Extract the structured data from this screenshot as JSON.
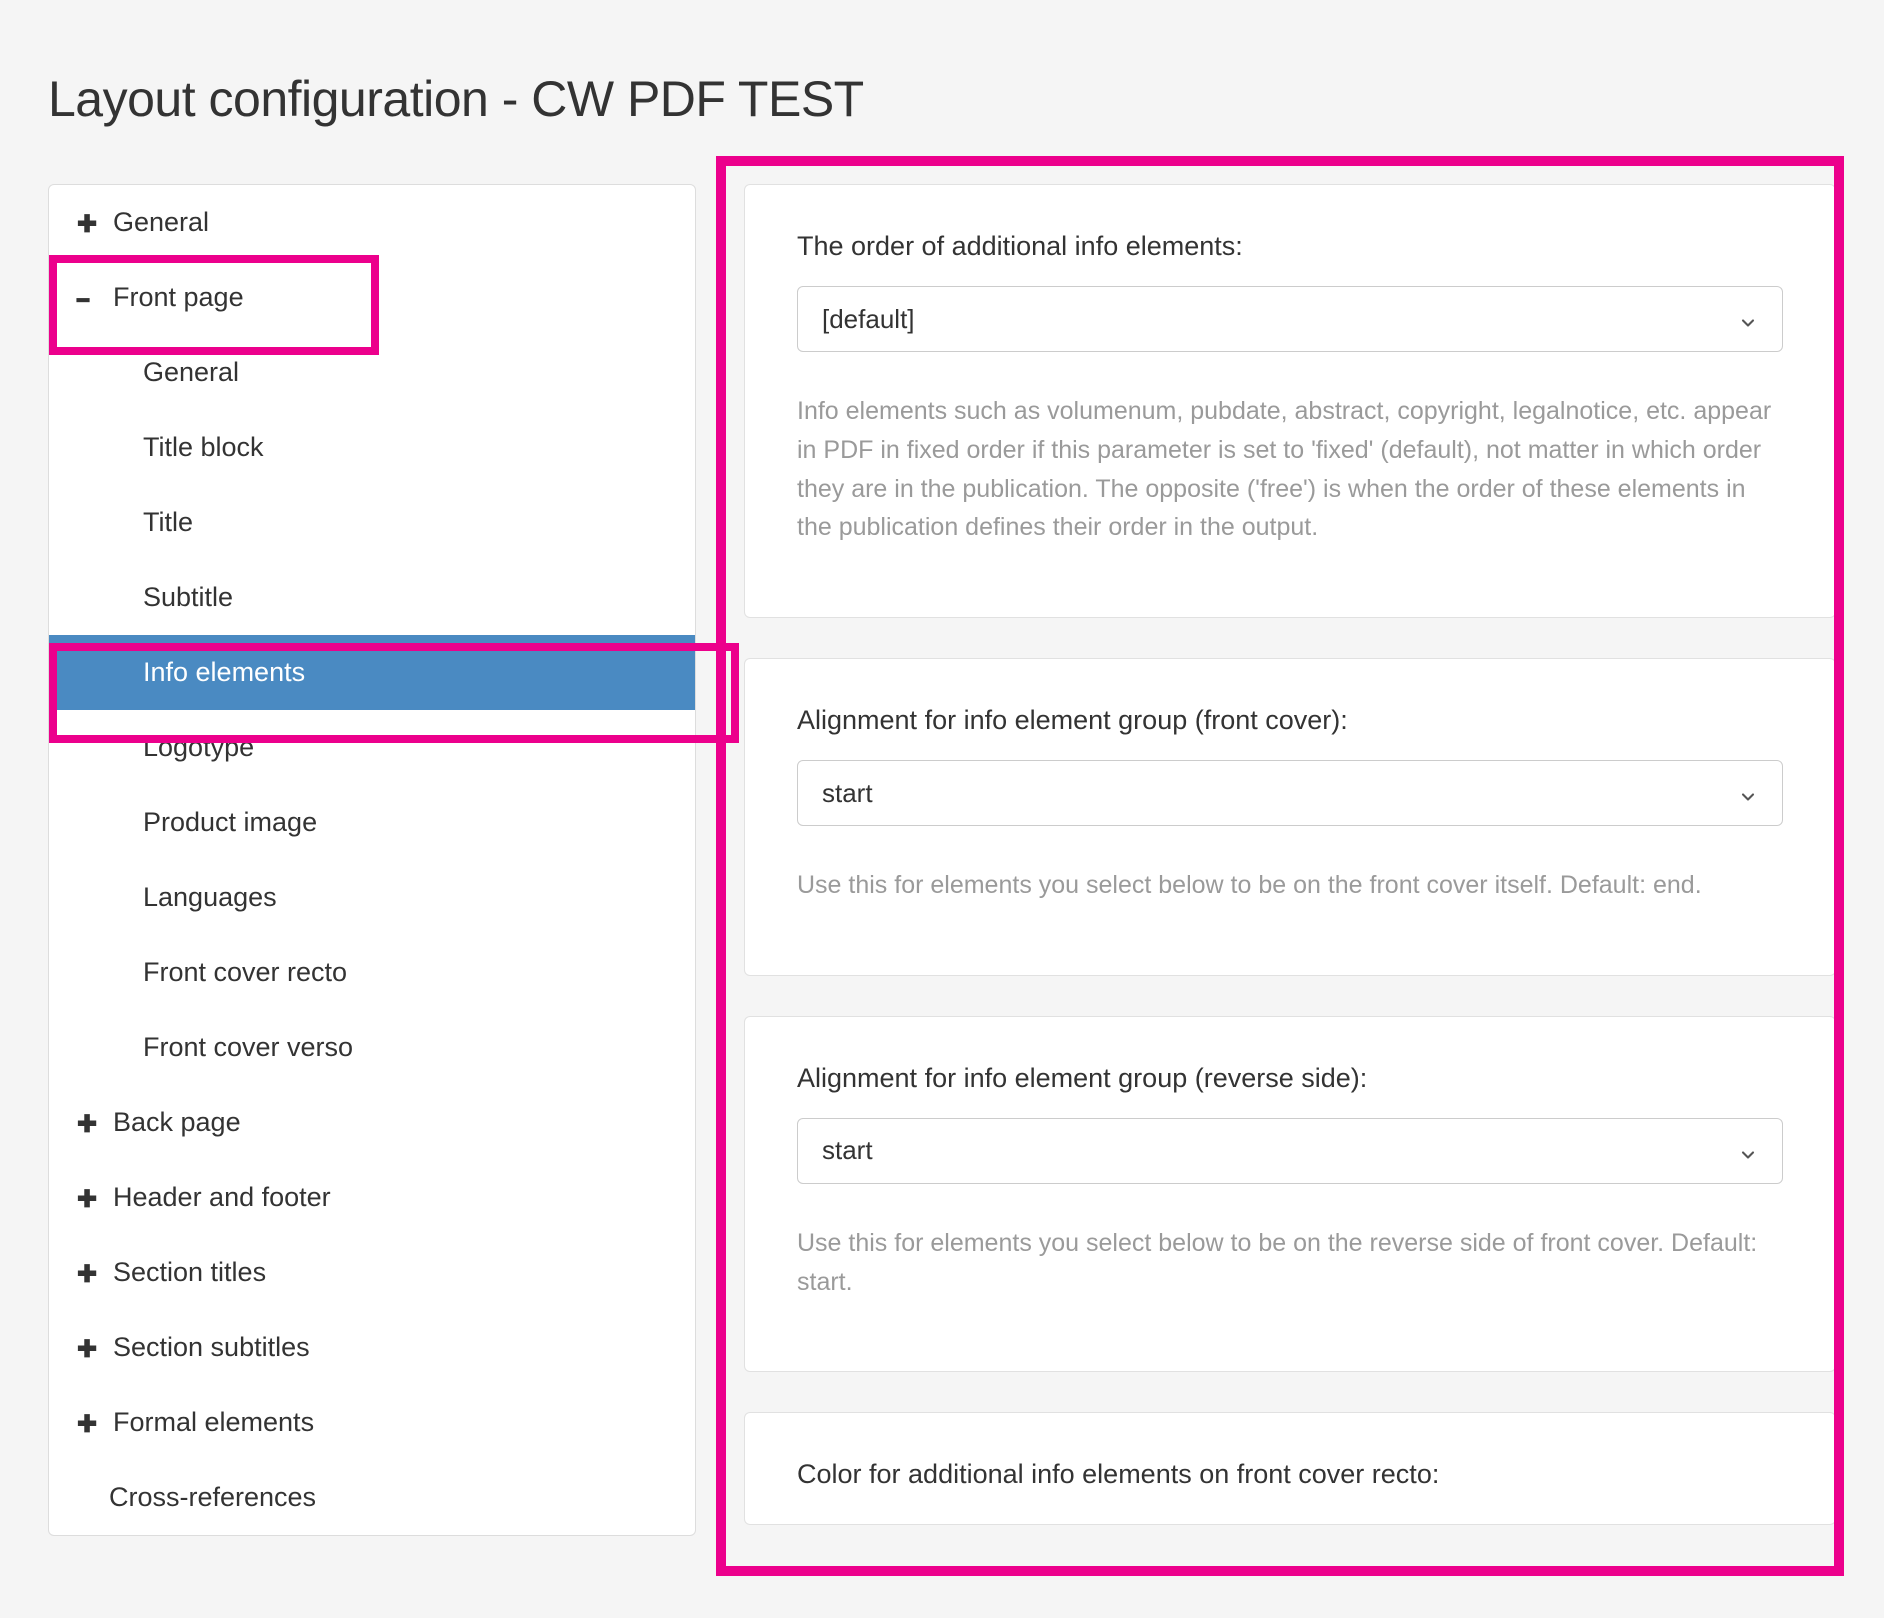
{
  "page": {
    "title": "Layout configuration - CW PDF TEST"
  },
  "sidebar": {
    "items": {
      "general": "General",
      "front_page": "Front page",
      "back_page": "Back page",
      "header_footer": "Header and footer",
      "section_titles": "Section titles",
      "section_subtitles": "Section subtitles",
      "formal_elements": "Formal elements",
      "cross_references": "Cross-references"
    },
    "front_page_children": {
      "general": "General",
      "title_block": "Title block",
      "title": "Title",
      "subtitle": "Subtitle",
      "info_elements": "Info elements",
      "logotype": "Logotype",
      "product_image": "Product image",
      "languages": "Languages",
      "front_cover_recto": "Front cover recto",
      "front_cover_verso": "Front cover verso"
    }
  },
  "main": {
    "card1": {
      "label": "The order of additional info elements:",
      "value": "[default]",
      "help": "Info elements such as volumenum, pubdate, abstract, copyright, legalnotice, etc. appear in PDF in fixed order if this parameter is set to 'fixed' (default), not matter in which order they are in the publication. The opposite ('free') is when the order of these elements in the publication defines their order in the output."
    },
    "card2": {
      "label": "Alignment for info element group (front cover):",
      "value": "start",
      "help": "Use this for elements you select below to be on the front cover itself. Default: end."
    },
    "card3": {
      "label": "Alignment for info element group (reverse side):",
      "value": "start",
      "help": "Use this for elements you select below to be on the reverse side of front cover. Default: start."
    },
    "card4": {
      "label": "Color for additional info elements on front cover recto:"
    }
  }
}
